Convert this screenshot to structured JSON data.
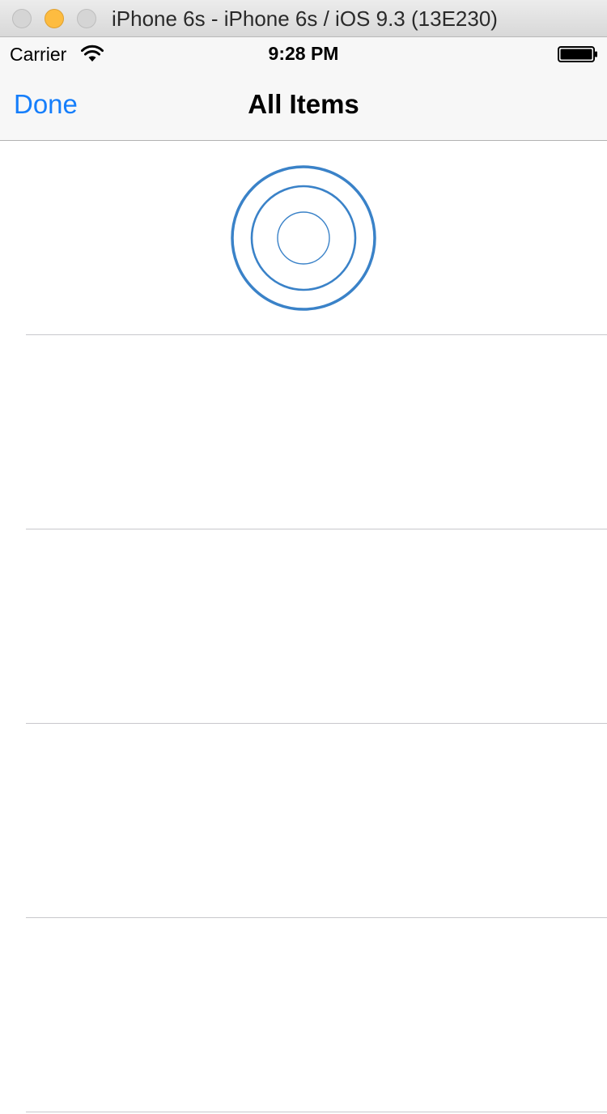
{
  "window": {
    "title": "iPhone 6s - iPhone 6s / iOS 9.3 (13E230)"
  },
  "status_bar": {
    "carrier": "Carrier",
    "time": "9:28 PM"
  },
  "nav_bar": {
    "left_button": "Done",
    "title": "All Items"
  },
  "table": {
    "rows": [
      {
        "content": "activity-indicator-icon"
      },
      {
        "content": ""
      },
      {
        "content": ""
      },
      {
        "content": ""
      },
      {
        "content": ""
      }
    ]
  },
  "colors": {
    "tint": "#157efb",
    "spinner": "#3a82c8",
    "separator": "#c8c7cc",
    "bar_background": "#f7f7f7"
  }
}
